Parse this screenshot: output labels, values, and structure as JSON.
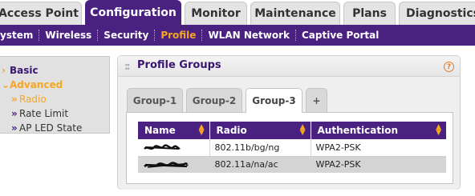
{
  "top_tabs": [
    "Access Point",
    "Configuration",
    "Monitor",
    "Maintenance",
    "Plans",
    "Diagnostics"
  ],
  "active_top_tab": "Configuration",
  "subnav": [
    "ystem",
    "Wireless",
    "Security",
    "Profile",
    "WLAN Network",
    "Captive Portal"
  ],
  "active_subnav": "Profile",
  "leftnav": {
    "basic": "Basic",
    "advanced": "Advanced",
    "items": [
      "Radio",
      "Rate Limit",
      "AP LED State"
    ]
  },
  "panel": {
    "title": "Profile Groups",
    "help": "?",
    "grip": "::"
  },
  "group_tabs": [
    "Group-1",
    "Group-2",
    "Group-3",
    "+"
  ],
  "active_group_tab": "Group-3",
  "table": {
    "columns": [
      "Name",
      "Radio",
      "Authentication"
    ],
    "rows": [
      {
        "radio": "802.11b/bg/ng",
        "auth": "WPA2-PSK"
      },
      {
        "radio": "802.11a/na/ac",
        "auth": "WPA2-PSK"
      }
    ]
  },
  "colors": {
    "brand_purple": "#4a2180",
    "accent_orange": "#f5a623"
  }
}
